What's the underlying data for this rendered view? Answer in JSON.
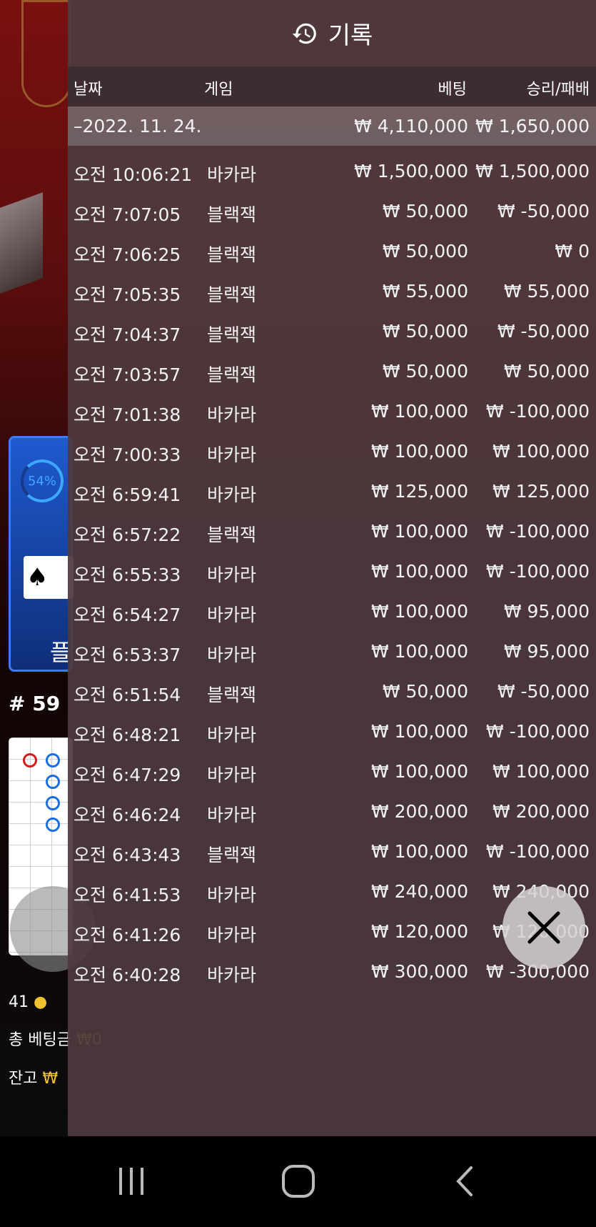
{
  "background": {
    "promo_percent": "54%",
    "promo_label": "플",
    "table_number": "# 59",
    "player_count": "41",
    "total_bet_label": "총 베팅금",
    "total_bet_value": "₩0",
    "balance_label": "잔고",
    "balance_value": "₩"
  },
  "panel": {
    "title": "기록",
    "columns": {
      "date": "날짜",
      "game": "게임",
      "bet": "베팅",
      "result": "승리/패배"
    },
    "date_row": {
      "date": "–2022. 11. 24.",
      "bet": "₩ 4,110,000",
      "result": "₩ 1,650,000"
    },
    "rows": [
      {
        "time": "오전 10:06:21",
        "game": "바카라",
        "bet": "₩ 1,500,000",
        "result": "₩ 1,500,000"
      },
      {
        "time": "오전 7:07:05",
        "game": "블랙잭",
        "bet": "₩ 50,000",
        "result": "₩ -50,000"
      },
      {
        "time": "오전 7:06:25",
        "game": "블랙잭",
        "bet": "₩ 50,000",
        "result": "₩ 0"
      },
      {
        "time": "오전 7:05:35",
        "game": "블랙잭",
        "bet": "₩ 55,000",
        "result": "₩ 55,000"
      },
      {
        "time": "오전 7:04:37",
        "game": "블랙잭",
        "bet": "₩ 50,000",
        "result": "₩ -50,000"
      },
      {
        "time": "오전 7:03:57",
        "game": "블랙잭",
        "bet": "₩ 50,000",
        "result": "₩ 50,000"
      },
      {
        "time": "오전 7:01:38",
        "game": "바카라",
        "bet": "₩ 100,000",
        "result": "₩ -100,000"
      },
      {
        "time": "오전 7:00:33",
        "game": "바카라",
        "bet": "₩ 100,000",
        "result": "₩ 100,000"
      },
      {
        "time": "오전 6:59:41",
        "game": "바카라",
        "bet": "₩ 125,000",
        "result": "₩ 125,000"
      },
      {
        "time": "오전 6:57:22",
        "game": "블랙잭",
        "bet": "₩ 100,000",
        "result": "₩ -100,000"
      },
      {
        "time": "오전 6:55:33",
        "game": "바카라",
        "bet": "₩ 100,000",
        "result": "₩ -100,000"
      },
      {
        "time": "오전 6:54:27",
        "game": "바카라",
        "bet": "₩ 100,000",
        "result": "₩ 95,000"
      },
      {
        "time": "오전 6:53:37",
        "game": "바카라",
        "bet": "₩ 100,000",
        "result": "₩ 95,000"
      },
      {
        "time": "오전 6:51:54",
        "game": "블랙잭",
        "bet": "₩ 50,000",
        "result": "₩ -50,000"
      },
      {
        "time": "오전 6:48:21",
        "game": "바카라",
        "bet": "₩ 100,000",
        "result": "₩ -100,000"
      },
      {
        "time": "오전 6:47:29",
        "game": "바카라",
        "bet": "₩ 100,000",
        "result": "₩ 100,000"
      },
      {
        "time": "오전 6:46:24",
        "game": "바카라",
        "bet": "₩ 200,000",
        "result": "₩ 200,000"
      },
      {
        "time": "오전 6:43:43",
        "game": "블랙잭",
        "bet": "₩ 100,000",
        "result": "₩ -100,000"
      },
      {
        "time": "오전 6:41:53",
        "game": "바카라",
        "bet": "₩ 240,000",
        "result": "₩ 240,000"
      },
      {
        "time": "오전 6:41:26",
        "game": "바카라",
        "bet": "₩ 120,000",
        "result": "₩ 120,000"
      },
      {
        "time": "오전 6:40:28",
        "game": "바카라",
        "bet": "₩ 300,000",
        "result": "₩ -300,000"
      }
    ]
  },
  "icons": {
    "history": "history-icon",
    "close": "close-icon",
    "nav_recents": "recents-icon",
    "nav_home": "home-icon",
    "nav_back": "back-icon"
  }
}
